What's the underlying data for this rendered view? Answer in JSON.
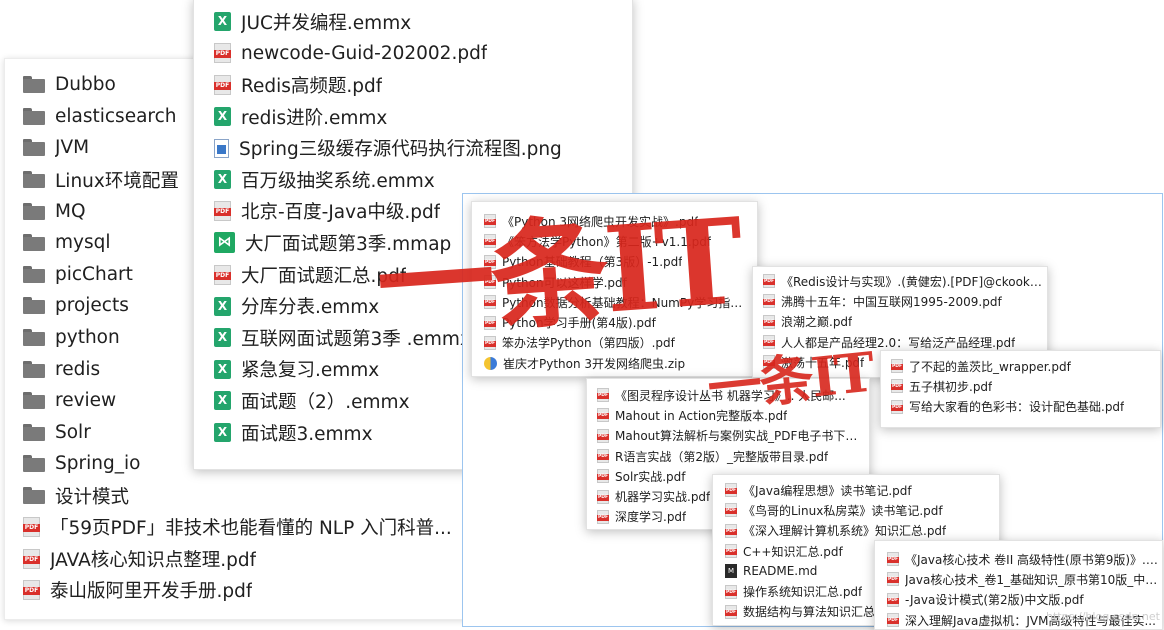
{
  "left_list": {
    "items": [
      {
        "icon": "folder-icon",
        "label": "Dubbo"
      },
      {
        "icon": "folder-icon",
        "label": "elasticsearch"
      },
      {
        "icon": "folder-icon",
        "label": "JVM"
      },
      {
        "icon": "folder-icon",
        "label": "Linux环境配置"
      },
      {
        "icon": "folder-icon",
        "label": "MQ"
      },
      {
        "icon": "folder-icon",
        "label": "mysql"
      },
      {
        "icon": "folder-icon",
        "label": "picChart"
      },
      {
        "icon": "folder-icon",
        "label": "projects"
      },
      {
        "icon": "folder-icon",
        "label": "python"
      },
      {
        "icon": "folder-icon",
        "label": "redis"
      },
      {
        "icon": "folder-icon",
        "label": "review"
      },
      {
        "icon": "folder-icon",
        "label": "Solr"
      },
      {
        "icon": "folder-icon",
        "label": "Spring_io"
      },
      {
        "icon": "folder-icon",
        "label": "设计模式"
      },
      {
        "icon": "pdf-icon",
        "label": "「59页PDF」非技术也能看懂的 NLP 入门科普..."
      },
      {
        "icon": "pdf-icon",
        "label": "JAVA核心知识点整理.pdf"
      },
      {
        "icon": "pdf-icon",
        "label": "泰山版阿里开发手册.pdf"
      }
    ]
  },
  "middle_list": {
    "items": [
      {
        "icon": "emmx-icon",
        "label": "JUC并发编程.emmx"
      },
      {
        "icon": "pdf-icon",
        "label": "newcode-Guid-202002.pdf"
      },
      {
        "icon": "pdf-icon",
        "label": "Redis高频题.pdf"
      },
      {
        "icon": "emmx-icon",
        "label": "redis进阶.emmx"
      },
      {
        "icon": "png-icon",
        "label": "Spring三级缓存源代码执行流程图.png"
      },
      {
        "icon": "emmx-icon",
        "label": "百万级抽奖系统.emmx"
      },
      {
        "icon": "pdf-icon",
        "label": "北京-百度-Java中级.pdf"
      },
      {
        "icon": "emmx-big-icon",
        "label": "大厂面试题第3季.mmap"
      },
      {
        "icon": "pdf-icon",
        "label": "大厂面试题汇总.pdf"
      },
      {
        "icon": "emmx-icon",
        "label": "分库分表.emmx"
      },
      {
        "icon": "emmx-icon",
        "label": "互联网面试题第3季 .emmx"
      },
      {
        "icon": "emmx-icon",
        "label": "紧急复习.emmx"
      },
      {
        "icon": "emmx-icon",
        "label": "面试题（2）.emmx"
      },
      {
        "icon": "emmx-icon",
        "label": "面试题3.emmx"
      }
    ]
  },
  "python_list": {
    "items": [
      {
        "icon": "pdf-icon",
        "label": "《Python 3网络爬虫开发实战》.pdf"
      },
      {
        "icon": "pdf-icon",
        "label": "《笨方法学Python》第二版+v1.1.pdf"
      },
      {
        "icon": "pdf-icon",
        "label": "Python基础教程（第3版）-1.pdf"
      },
      {
        "icon": "pdf-icon",
        "label": "Python可以这样学.pdf"
      },
      {
        "icon": "pdf-icon",
        "label": "Python数据分析基础教程：NumPy学习指南（..."
      },
      {
        "icon": "pdf-icon",
        "label": "Python学习手册(第4版).pdf"
      },
      {
        "icon": "pdf-icon",
        "label": "笨办法学Python（第四版）.pdf"
      },
      {
        "icon": "zip-icon",
        "label": "崔庆才Python 3开发网络爬虫.zip"
      }
    ]
  },
  "redis_list": {
    "items": [
      {
        "icon": "pdf-icon",
        "label": "《Redis设计与实现》.(黄健宏).[PDF]@ckook.pdf"
      },
      {
        "icon": "pdf-icon",
        "label": "沸腾十五年：中国互联网1995-2009.pdf"
      },
      {
        "icon": "pdf-icon",
        "label": "浪潮之巅.pdf"
      },
      {
        "icon": "pdf-icon",
        "label": "人人都是产品经理2.0：写给泛产品经理.pdf"
      },
      {
        "icon": "pdf-icon",
        "label": "激荡十五年.pdf"
      }
    ]
  },
  "design_list": {
    "items": [
      {
        "icon": "pdf-icon",
        "label": "了不起的盖茨比_wrapper.pdf"
      },
      {
        "icon": "pdf-icon",
        "label": "五子棋初步.pdf"
      },
      {
        "icon": "pdf-icon",
        "label": "写给大家看的色彩书：设计配色基础.pdf"
      }
    ]
  },
  "ml_list": {
    "items": [
      {
        "icon": "pdf-icon",
        "label": "《图灵程序设计丛书 机器学习》.. 人民邮..."
      },
      {
        "icon": "pdf-icon",
        "label": "Mahout in Action完整版本.pdf"
      },
      {
        "icon": "pdf-icon",
        "label": "Mahout算法解析与案例实战_PDF电子书下载+..."
      },
      {
        "icon": "pdf-icon",
        "label": "R语言实战（第2版）_完整版带目录.pdf"
      },
      {
        "icon": "pdf-icon",
        "label": "Solr实战.pdf"
      },
      {
        "icon": "pdf-icon",
        "label": "机器学习实战.pdf"
      },
      {
        "icon": "pdf-icon",
        "label": "深度学习.pdf"
      }
    ]
  },
  "notes_list": {
    "items": [
      {
        "icon": "pdf-icon",
        "label": "《Java编程思想》读书笔记.pdf"
      },
      {
        "icon": "pdf-icon",
        "label": "《鸟哥的Linux私房菜》读书笔记.pdf"
      },
      {
        "icon": "pdf-icon",
        "label": "《深入理解计算机系统》知识汇总.pdf"
      },
      {
        "icon": "pdf-icon",
        "label": "C++知识汇总.pdf"
      },
      {
        "icon": "md-icon",
        "label": "README.md"
      },
      {
        "icon": "pdf-icon",
        "label": "操作系统知识汇总.pdf"
      },
      {
        "icon": "pdf-icon",
        "label": "数据结构与算法知识汇总.pdf"
      }
    ]
  },
  "java_list": {
    "items": [
      {
        "icon": "pdf-icon",
        "label": "《Java核心技术 卷II 高级特性(原书第9版)》.(..."
      },
      {
        "icon": "pdf-icon",
        "label": "Java核心技术_卷1_基础知识_原书第10版_中文..."
      },
      {
        "icon": "pdf-icon",
        "label": "-Java设计模式(第2版)中文版.pdf"
      },
      {
        "icon": "pdf-icon",
        "label": "深入理解Java虚拟机：JVM高级特性与最佳实..."
      }
    ]
  },
  "watermarks": {
    "large": "一条IT",
    "small": "一条IT",
    "color": "#d8261c"
  },
  "credit": "https://blog.csdn.net"
}
